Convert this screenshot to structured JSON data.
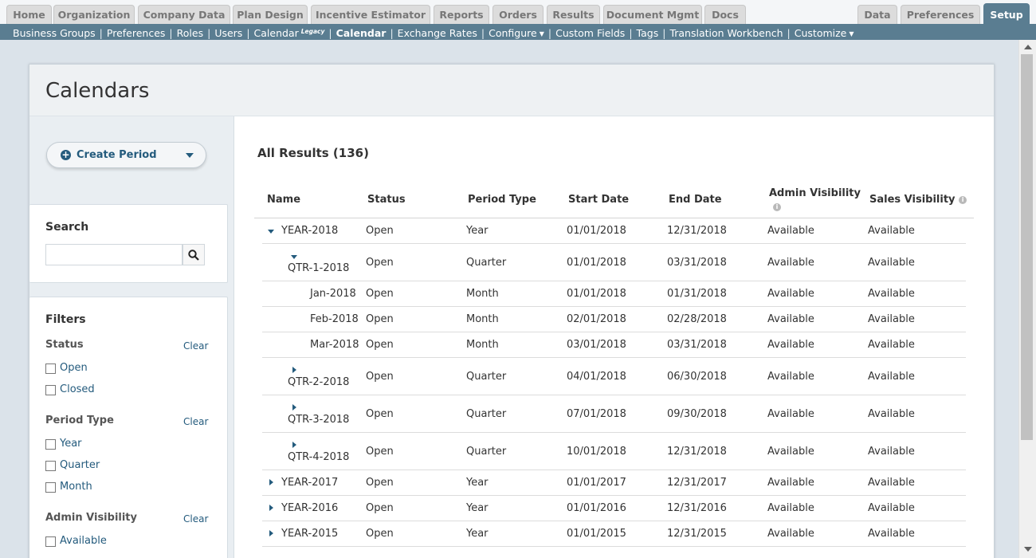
{
  "top_tabs": [
    {
      "label": "Home"
    },
    {
      "label": "Organization"
    },
    {
      "label": "Company Data"
    },
    {
      "label": "Plan Design"
    },
    {
      "label": "Incentive Estimator"
    },
    {
      "label": "Reports"
    },
    {
      "label": "Orders"
    },
    {
      "label": "Results"
    },
    {
      "label": "Document Mgmt"
    },
    {
      "label": "Docs"
    },
    {
      "label": "Data"
    },
    {
      "label": "Preferences"
    },
    {
      "label": "Setup"
    }
  ],
  "subnav": {
    "items": [
      {
        "label": "Business Groups"
      },
      {
        "label": "Preferences"
      },
      {
        "label": "Roles"
      },
      {
        "label": "Users"
      },
      {
        "label": "Calendar",
        "badge": "Legacy"
      },
      {
        "label": "Calendar"
      },
      {
        "label": "Exchange Rates"
      },
      {
        "label": "Configure"
      },
      {
        "label": "Custom Fields"
      },
      {
        "label": "Tags"
      },
      {
        "label": "Translation Workbench"
      },
      {
        "label": "Customize"
      }
    ],
    "separator": "|"
  },
  "page": {
    "title": "Calendars",
    "create_button_label": "Create Period",
    "create_button_icon": "plus-circle-icon"
  },
  "search": {
    "title": "Search",
    "placeholder": "",
    "value": ""
  },
  "filters": {
    "title": "Filters",
    "clear_label": "Clear",
    "groups": [
      {
        "title": "Status",
        "options": [
          "Open",
          "Closed"
        ]
      },
      {
        "title": "Period Type",
        "options": [
          "Year",
          "Quarter",
          "Month"
        ]
      },
      {
        "title": "Admin Visibility",
        "options": [
          "Available"
        ]
      }
    ]
  },
  "results": {
    "title": "All Results (136)",
    "columns": [
      "Name",
      "Status",
      "Period Type",
      "Start Date",
      "End Date",
      "Admin Visibility",
      "Sales Visibility"
    ],
    "rows": [
      {
        "name": "YEAR-2018",
        "status": "Open",
        "type": "Year",
        "start": "01/01/2018",
        "end": "12/31/2018",
        "admin": "Available",
        "sales": "Available",
        "expander": "expanded"
      },
      {
        "name": "QTR-1-2018",
        "status": "Open",
        "type": "Quarter",
        "start": "01/01/2018",
        "end": "03/31/2018",
        "admin": "Available",
        "sales": "Available",
        "expander": "expanded"
      },
      {
        "name": "Jan-2018",
        "status": "Open",
        "type": "Month",
        "start": "01/01/2018",
        "end": "01/31/2018",
        "admin": "Available",
        "sales": "Available",
        "expander": "none"
      },
      {
        "name": "Feb-2018",
        "status": "Open",
        "type": "Month",
        "start": "02/01/2018",
        "end": "02/28/2018",
        "admin": "Available",
        "sales": "Available",
        "expander": "none"
      },
      {
        "name": "Mar-2018",
        "status": "Open",
        "type": "Month",
        "start": "03/01/2018",
        "end": "03/31/2018",
        "admin": "Available",
        "sales": "Available",
        "expander": "none"
      },
      {
        "name": "QTR-2-2018",
        "status": "Open",
        "type": "Quarter",
        "start": "04/01/2018",
        "end": "06/30/2018",
        "admin": "Available",
        "sales": "Available",
        "expander": "collapsed"
      },
      {
        "name": "QTR-3-2018",
        "status": "Open",
        "type": "Quarter",
        "start": "07/01/2018",
        "end": "09/30/2018",
        "admin": "Available",
        "sales": "Available",
        "expander": "collapsed"
      },
      {
        "name": "QTR-4-2018",
        "status": "Open",
        "type": "Quarter",
        "start": "10/01/2018",
        "end": "12/31/2018",
        "admin": "Available",
        "sales": "Available",
        "expander": "collapsed"
      },
      {
        "name": "YEAR-2017",
        "status": "Open",
        "type": "Year",
        "start": "01/01/2017",
        "end": "12/31/2017",
        "admin": "Available",
        "sales": "Available",
        "expander": "collapsed"
      },
      {
        "name": "YEAR-2016",
        "status": "Open",
        "type": "Year",
        "start": "01/01/2016",
        "end": "12/31/2016",
        "admin": "Available",
        "sales": "Available",
        "expander": "collapsed"
      },
      {
        "name": "YEAR-2015",
        "status": "Open",
        "type": "Year",
        "start": "01/01/2015",
        "end": "12/31/2015",
        "admin": "Available",
        "sales": "Available",
        "expander": "collapsed"
      }
    ]
  },
  "colors": {
    "nav_bar": "#5a7d91",
    "link": "#245b7d",
    "panel_bg": "#e9eef2",
    "page_bg": "#dbe3ea"
  }
}
